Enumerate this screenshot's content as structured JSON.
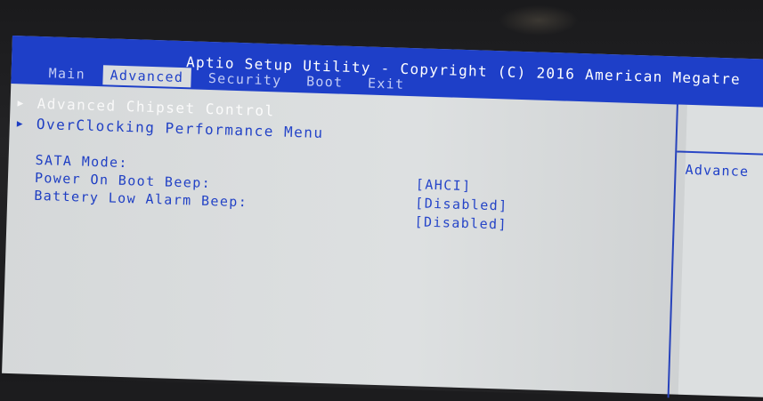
{
  "title": "Aptio Setup Utility - Copyright (C) 2016 American Megatre",
  "tabs": [
    {
      "label": "Main"
    },
    {
      "label": "Advanced"
    },
    {
      "label": "Security"
    },
    {
      "label": "Boot"
    },
    {
      "label": "Exit"
    }
  ],
  "active_tab": "Advanced",
  "menu": [
    {
      "label": "Advanced Chipset Control"
    },
    {
      "label": "OverClocking Performance Menu"
    }
  ],
  "settings": [
    {
      "label": "SATA Mode:",
      "value": "[AHCI]"
    },
    {
      "label": "Power On Boot Beep:",
      "value": "[Disabled]"
    },
    {
      "label": "Battery Low Alarm Beep:",
      "value": "[Disabled]"
    }
  ],
  "help": {
    "title": "Advance"
  },
  "colors": {
    "title_bar": "#1e3fc8",
    "screen_bg": "#dcdfe0",
    "text": "#1e3fc8",
    "selected_text": "#ffffff"
  },
  "icons": {
    "submenu": "triangle-right-icon"
  }
}
